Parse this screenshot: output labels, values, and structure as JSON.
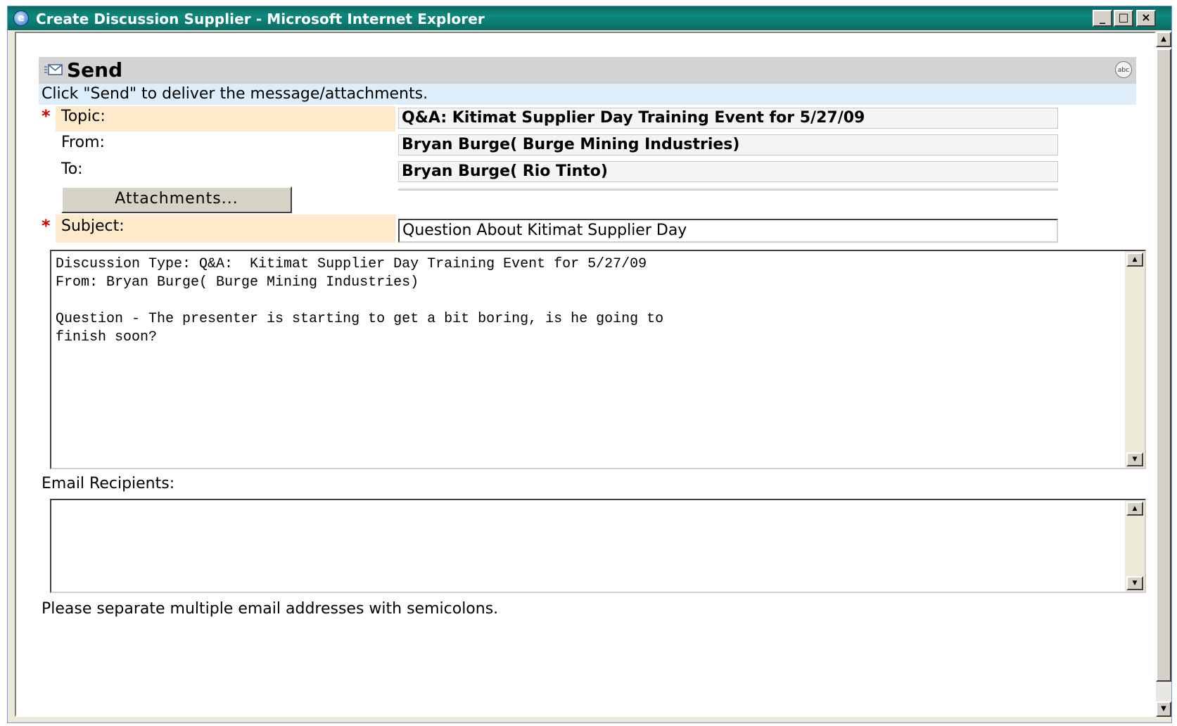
{
  "window": {
    "title": "Create Discussion Supplier - Microsoft Internet Explorer",
    "minimize_glyph": "_",
    "maximize_glyph": "□",
    "close_glyph": "×"
  },
  "header": {
    "title": "Send",
    "icon": "envelope-icon",
    "spell_icon_text": "abc"
  },
  "instructions": "Click \"Send\" to deliver the message/attachments.",
  "form": {
    "required_marker": "*",
    "topic_label": "Topic:",
    "topic_value": "Q&A: Kitimat Supplier Day Training Event for 5/27/09",
    "from_label": "From:",
    "from_value": "Bryan Burge( Burge Mining Industries)",
    "to_label": "To:",
    "to_value": "Bryan Burge( Rio Tinto)",
    "attachments_button": "Attachments...",
    "subject_label": "Subject:",
    "subject_value": "Question About Kitimat Supplier Day",
    "message_body": "Discussion Type: Q&A:  Kitimat Supplier Day Training Event for 5/27/09\nFrom: Bryan Burge( Burge Mining Industries)\n\nQuestion - The presenter is starting to get a bit boring, is he going to\nfinish soon?",
    "email_recipients_label": "Email Recipients:",
    "email_recipients_value": "",
    "email_hint": "Please separate multiple email addresses with semicolons."
  },
  "scroll_glyphs": {
    "up": "▲",
    "down": "▼"
  }
}
